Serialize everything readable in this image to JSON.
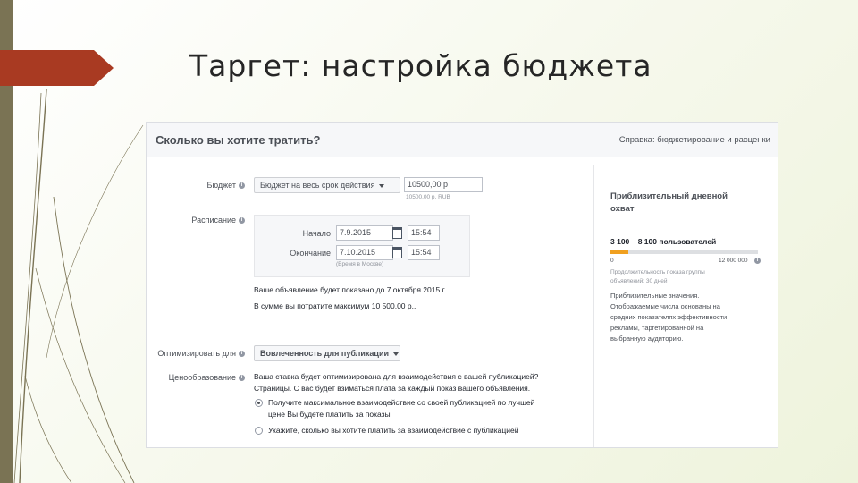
{
  "slide": {
    "title": "Таргет: настройка бюджета"
  },
  "panel": {
    "title": "Сколько вы хотите тратить?",
    "help_link": "Справка: бюджетирование и расценки"
  },
  "budget": {
    "label": "Бюджет",
    "type_dropdown": "Бюджет на весь срок действия",
    "amount_value": "10500,00 р",
    "amount_hint": "10500,00 р. RUB"
  },
  "schedule": {
    "label": "Расписание",
    "start_label": "Начало",
    "start_date": "7.9.2015",
    "start_time": "15:54",
    "end_label": "Окончание",
    "end_date": "7.10.2015",
    "end_time": "15:54",
    "timezone_note": "(Время в Москве)"
  },
  "summary": {
    "line1": "Ваше объявление будет показано до 7 октября 2015 г..",
    "line2": "В сумме вы потратите максимум 10 500,00 р.."
  },
  "optimize": {
    "label": "Оптимизировать для",
    "dropdown": "Вовлеченность для публикации"
  },
  "pricing": {
    "label": "Ценообразование",
    "desc_line1": "Ваша ставка будет оптимизирована для взаимодействия с вашей публикацией?",
    "desc_line2": "Страницы. С вас будет взиматься плата за каждый показ вашего объявления.",
    "option1_line1": "Получите максимальное взаимодействие со своей публикацией по лучшей",
    "option1_line2": "цене   Вы будете платить за показы",
    "option2": "Укажите, сколько вы хотите платить за взаимодействие с публикацией"
  },
  "estimate": {
    "title": "Приблизительный дневной охват",
    "range": "3 100 – 8 100 пользователей",
    "fill_fraction": 0.12,
    "scale_min": "0",
    "scale_max": "12 000 000",
    "audience_note_line1": "Продолжительность показа группы",
    "audience_note_line2": "объявлений: 30 дней",
    "note_line1": "Приблизительные значения.",
    "note_line2": "Отображаемые числа основаны на",
    "note_line3": "средних показателях эффективности",
    "note_line4": "рекламы, таргетированной на",
    "note_line5": "выбранную аудиторию."
  },
  "colors": {
    "accent_bar": "#f0a020",
    "slide_tab": "#a93a22",
    "left_bar": "#7a7354"
  }
}
